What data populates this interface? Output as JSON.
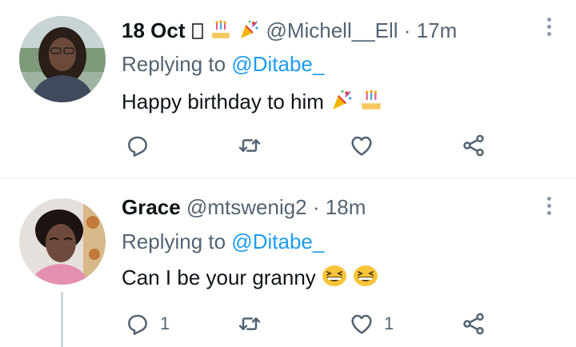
{
  "tweets": [
    {
      "name": "18 Oct",
      "handle": "@Michell__Ell",
      "separator": "·",
      "time": "17m",
      "replying_prefix": "Replying to",
      "replying_to": "@Ditabe_",
      "text": "Happy birthday to him",
      "name_emojis": [
        "missing-glyph",
        "birthday-cake",
        "party-popper"
      ],
      "text_emojis": [
        "party-popper",
        "birthday-cake"
      ],
      "reply_count": "",
      "retweet_count": "",
      "like_count": ""
    },
    {
      "name": "Grace",
      "handle": "@mtswenig2",
      "separator": "·",
      "time": "18m",
      "replying_prefix": "Replying to",
      "replying_to": "@Ditabe_",
      "text": "Can I be your granny",
      "text_emojis": [
        "grinning-squinting-face",
        "grinning-squinting-face"
      ],
      "reply_count": "1",
      "retweet_count": "",
      "like_count": "1"
    }
  ],
  "colors": {
    "text": "#0f1419",
    "secondary": "#536471",
    "link": "#1d9bf0",
    "divider": "#eff3f4"
  },
  "icons": [
    "reply-icon",
    "retweet-icon",
    "like-icon",
    "share-icon",
    "more-icon"
  ]
}
